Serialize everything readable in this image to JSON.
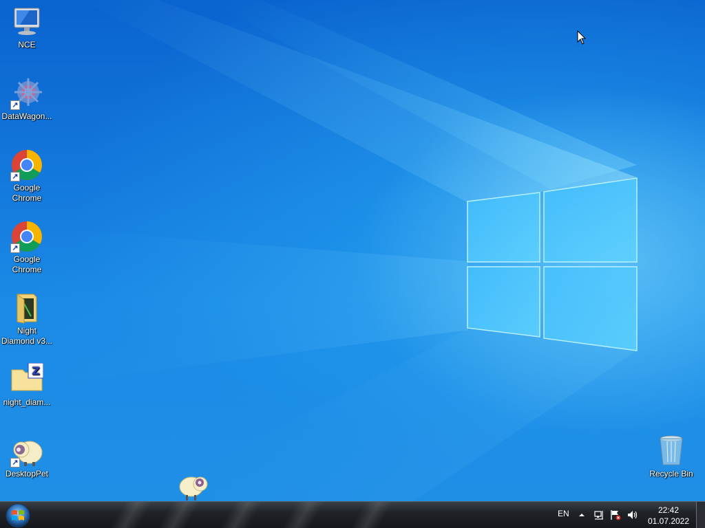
{
  "desktop": {
    "icons": [
      {
        "label": "NCE",
        "icon": "computer-monitor-icon"
      },
      {
        "label": "DataWagon...",
        "icon": "datawagon-app-icon"
      },
      {
        "label": "Google Chrome",
        "icon": "chrome-icon"
      },
      {
        "label": "Google Chrome",
        "icon": "chrome-icon"
      },
      {
        "label": "Night Diamond v3...",
        "icon": "folder-icon"
      },
      {
        "label": "night_diam...",
        "icon": "zip-folder-icon"
      },
      {
        "label": "DesktopPet",
        "icon": "sheep-icon"
      }
    ],
    "recycle_bin": {
      "label": "Recycle Bin",
      "icon": "recycle-bin-icon"
    },
    "pet": {
      "icon": "sheep-pet-icon"
    }
  },
  "taskbar": {
    "start_icon": "windows-orb-icon",
    "language": "EN",
    "tray_icons": [
      "chevron-up-icon",
      "network-icon",
      "action-center-flag-icon",
      "volume-icon"
    ],
    "clock": {
      "time": "22:42",
      "date": "01.07.2022"
    }
  },
  "colors": {
    "accent": "#1a8ae6",
    "taskbar": "#1f2328"
  }
}
